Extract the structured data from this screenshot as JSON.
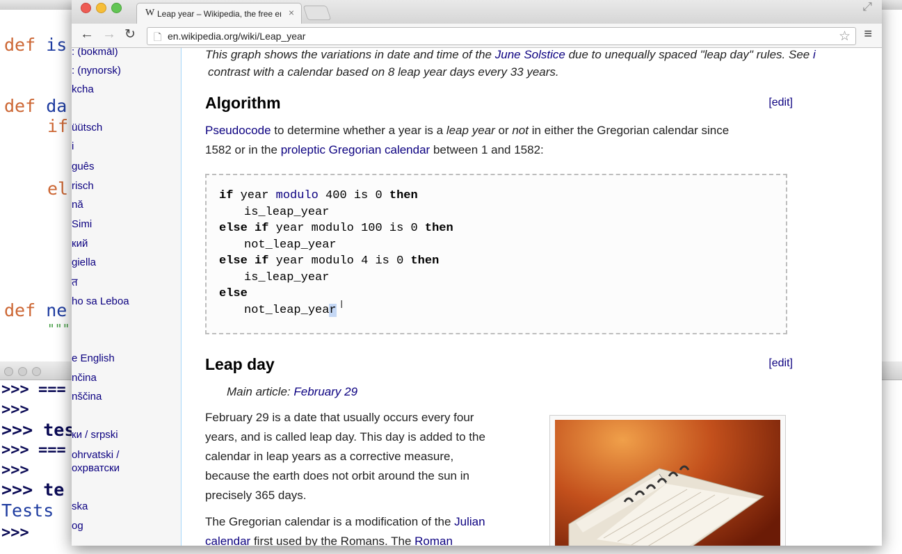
{
  "editor": {
    "lines": [
      "def",
      "is",
      "def",
      "da",
      "if",
      "el",
      "def",
      "ne"
    ],
    "docstring": "\"\"\""
  },
  "shell": {
    "prompt": ">>>",
    "fragments": [
      "===",
      "tes",
      "===",
      "te",
      "Tests"
    ]
  },
  "browser": {
    "tab_title": "Leap year – Wikipedia, the free encyclopedia",
    "tab_favicon": "W",
    "url": "en.wikipedia.org/wiki/Leap_year",
    "icons": [
      "back-arrow-icon",
      "forward-arrow-icon",
      "reload-icon",
      "page-icon",
      "star-icon",
      "menu-icon",
      "resize-icon"
    ]
  },
  "sidebar": {
    "languages": [
      ": (bokmål)",
      ": (nynorsk)",
      "kcha",
      "üütsch",
      "i",
      "guês",
      "risch",
      "nă",
      "Simi",
      "кий",
      "giella",
      "त",
      "ho sa Leboa",
      "e English",
      "nčina",
      "nščina",
      "ки / srpski",
      "ohrvatski /",
      "охрватски",
      "ska",
      "og"
    ]
  },
  "article": {
    "caption_line1_a": "This graph shows the variations in date and time of the ",
    "caption_link": "June Solstice",
    "caption_line1_b": " due to unequally spaced \"leap day\" rules. See ",
    "caption_link2": "i",
    "caption_line2": "contrast with a calendar based on 8 leap year days every 33 years.",
    "algorithm_heading": "Algorithm",
    "edit_label": "[edit]",
    "algo_link1": "Pseudocode",
    "algo_text1": " to determine whether a year is a ",
    "algo_em1": "leap year",
    "algo_text2": " or ",
    "algo_em2": "not",
    "algo_text3": " in either the Gregorian calendar since",
    "algo_line2_a": "1582 or in the ",
    "algo_link2": "proleptic Gregorian calendar",
    "algo_line2_b": " between 1 and 1582:",
    "code": {
      "if": "if",
      "else": "else",
      "then": "then",
      "is": "is",
      "year": "year",
      "modulo": "modulo",
      "n400": "400",
      "n100": "100",
      "n4": "4",
      "zero": "0",
      "is_leap": "is_leap_year",
      "not_leap": "not_leap_year",
      "not_leap_a": "not_leap_yea",
      "not_leap_b": "r"
    },
    "leap_day_heading": "Leap day",
    "main_article_prefix": "Main article: ",
    "main_article_link": "February 29",
    "p1": [
      "February 29 is a date that usually occurs every four",
      "years, and is called leap day. This day is added to the",
      "calendar in leap years as a corrective measure,",
      "because the earth does not orbit around the sun in",
      "precisely 365 days."
    ],
    "p2_a": "The Gregorian calendar is a modification of the ",
    "p2_link1": "Julian",
    "p2_link1b": "calendar",
    "p2_b": " first used by the Romans. The ",
    "p2_link2": "Roman"
  }
}
